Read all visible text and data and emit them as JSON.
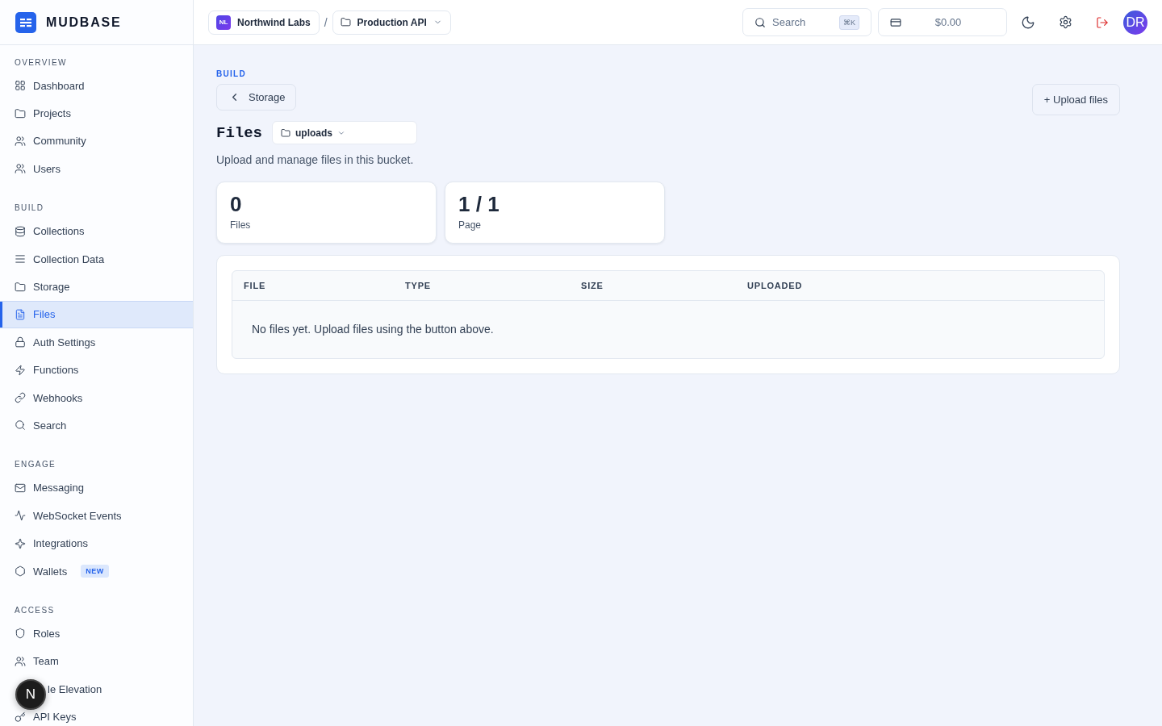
{
  "brand": {
    "name": "MUDBASE"
  },
  "sidebar": {
    "sections": [
      {
        "title": "OVERVIEW",
        "items": [
          {
            "label": "Dashboard",
            "selected": false
          },
          {
            "label": "Projects",
            "selected": false
          },
          {
            "label": "Community",
            "selected": false
          },
          {
            "label": "Users",
            "selected": false
          }
        ]
      },
      {
        "title": "BUILD",
        "items": [
          {
            "label": "Collections",
            "selected": false
          },
          {
            "label": "Collection Data",
            "selected": false
          },
          {
            "label": "Storage",
            "selected": false
          },
          {
            "label": "Files",
            "selected": true
          },
          {
            "label": "Auth Settings",
            "selected": false
          },
          {
            "label": "Functions",
            "selected": false
          },
          {
            "label": "Webhooks",
            "selected": false
          },
          {
            "label": "Search",
            "selected": false
          }
        ]
      },
      {
        "title": "ENGAGE",
        "items": [
          {
            "label": "Messaging",
            "selected": false
          },
          {
            "label": "WebSocket Events",
            "selected": false
          },
          {
            "label": "Integrations",
            "selected": false
          },
          {
            "label": "Wallets",
            "selected": false,
            "badge": "NEW"
          }
        ]
      },
      {
        "title": "ACCESS",
        "items": [
          {
            "label": "Roles",
            "selected": false
          },
          {
            "label": "Team",
            "selected": false
          },
          {
            "label": "le Elevation",
            "selected": false
          },
          {
            "label": "API Keys",
            "selected": false
          }
        ]
      }
    ]
  },
  "floating_button": {
    "label": "N"
  },
  "header": {
    "org": {
      "initials": "NL",
      "name": "Northwind Labs"
    },
    "separator": "/",
    "project": "Production API",
    "search": {
      "placeholder": "Search",
      "shortcut": "⌘K"
    },
    "balance": "$0.00",
    "avatar": "DR"
  },
  "page": {
    "section": "BUILD",
    "back": "Storage",
    "title": "Files",
    "bucket": "uploads",
    "description": "Upload and manage files in this bucket.",
    "upload_button": "+ Upload files",
    "stats": [
      {
        "value": "0",
        "label": "Files"
      },
      {
        "value": "1 / 1",
        "label": "Page"
      }
    ],
    "table": {
      "columns": [
        "FILE",
        "TYPE",
        "SIZE",
        "UPLOADED"
      ],
      "empty": "No files yet. Upload files using the button above."
    }
  }
}
